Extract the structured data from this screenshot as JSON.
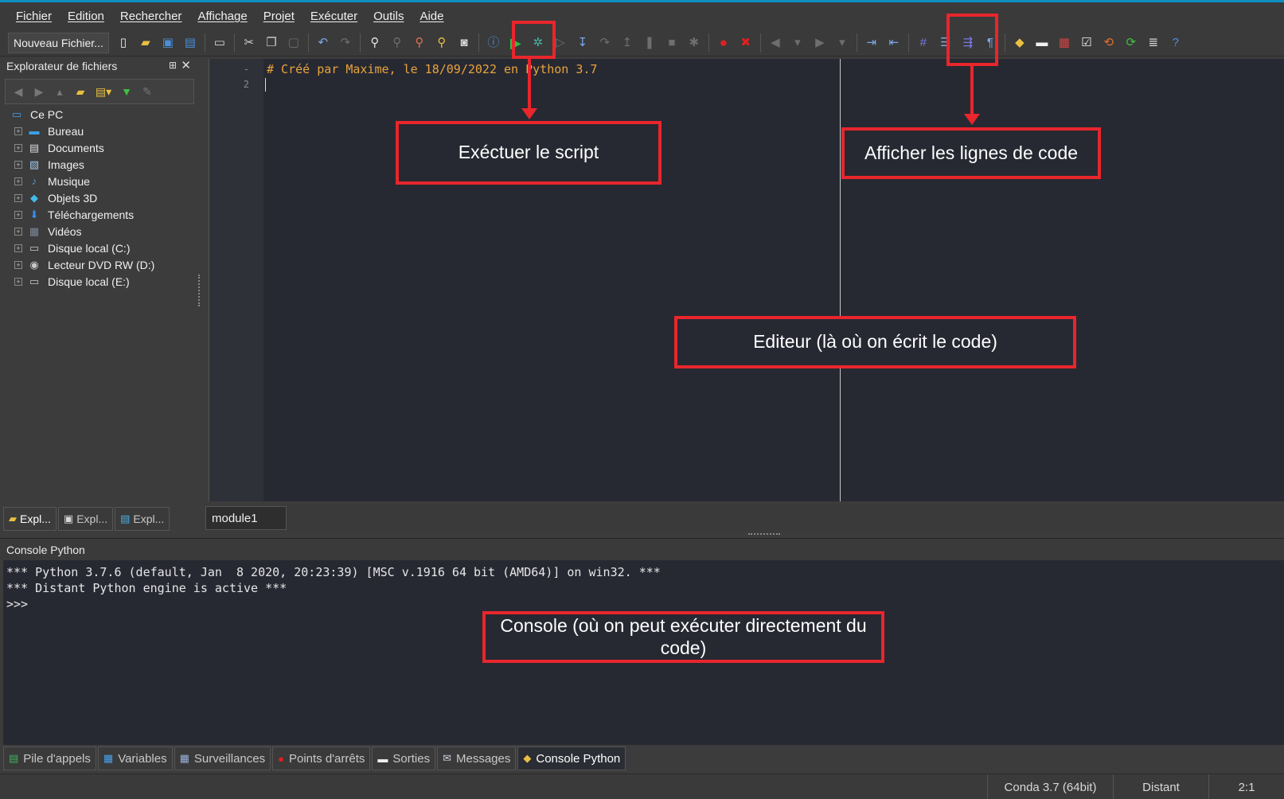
{
  "menu": {
    "items": [
      "Fichier",
      "Edition",
      "Rechercher",
      "Affichage",
      "Projet",
      "Exécuter",
      "Outils",
      "Aide"
    ]
  },
  "toolbar": {
    "new_file_label": "Nouveau Fichier..."
  },
  "explorer": {
    "title": "Explorateur de fichiers",
    "pin_glyph": "⊞",
    "close_glyph": "✕",
    "root": "Ce PC",
    "items": [
      {
        "label": "Bureau",
        "icon": "desktop-icon",
        "color": "#3aa0e8"
      },
      {
        "label": "Documents",
        "icon": "documents-icon",
        "color": "#d8dbe0"
      },
      {
        "label": "Images",
        "icon": "images-icon",
        "color": "#9fc8ea"
      },
      {
        "label": "Musique",
        "icon": "music-icon",
        "color": "#3aa0e8"
      },
      {
        "label": "Objets 3D",
        "icon": "objects3d-icon",
        "color": "#45b9e8"
      },
      {
        "label": "Téléchargements",
        "icon": "downloads-icon",
        "color": "#3a8fe8"
      },
      {
        "label": "Vidéos",
        "icon": "videos-icon",
        "color": "#7a8898"
      },
      {
        "label": "Disque local (C:)",
        "icon": "drive-c-icon",
        "color": "#c8c8c8"
      },
      {
        "label": "Lecteur DVD RW (D:)",
        "icon": "dvd-drive-icon",
        "color": "#c8c8c8"
      },
      {
        "label": "Disque local (E:)",
        "icon": "drive-e-icon",
        "color": "#c8c8c8"
      }
    ],
    "tabs": [
      "Expl...",
      "Expl...",
      "Expl..."
    ]
  },
  "editor": {
    "line_numbers": [
      "-",
      "2"
    ],
    "code_line_1": "# Créé par Maxime, le 18/09/2022 en Python 3.7",
    "tab_label": "module1"
  },
  "console": {
    "title": "Console Python",
    "lines": [
      "*** Python 3.7.6 (default, Jan  8 2020, 20:23:39) [MSC v.1916 64 bit (AMD64)] on win32. ***",
      "*** Distant Python engine is active ***",
      ">>>"
    ]
  },
  "bottom_tabs": [
    "Pile d'appels",
    "Variables",
    "Surveillances",
    "Points d'arrêts",
    "Sorties",
    "Messages",
    "Console Python"
  ],
  "status": {
    "interpreter": "Conda 3.7 (64bit)",
    "mode": "Distant",
    "position": "2:1"
  },
  "annotations": {
    "run_script": "Exéctuer le script",
    "show_line_numbers": "Afficher les lignes de code",
    "editor": "Editeur (là où on écrit le code)",
    "console": "Console (où on peut exécuter directement du code)"
  },
  "colors": {
    "annotation_red": "#e8262c",
    "editor_bg": "#272932",
    "comment": "#e8a33d",
    "accent": "#0e8fc0"
  }
}
